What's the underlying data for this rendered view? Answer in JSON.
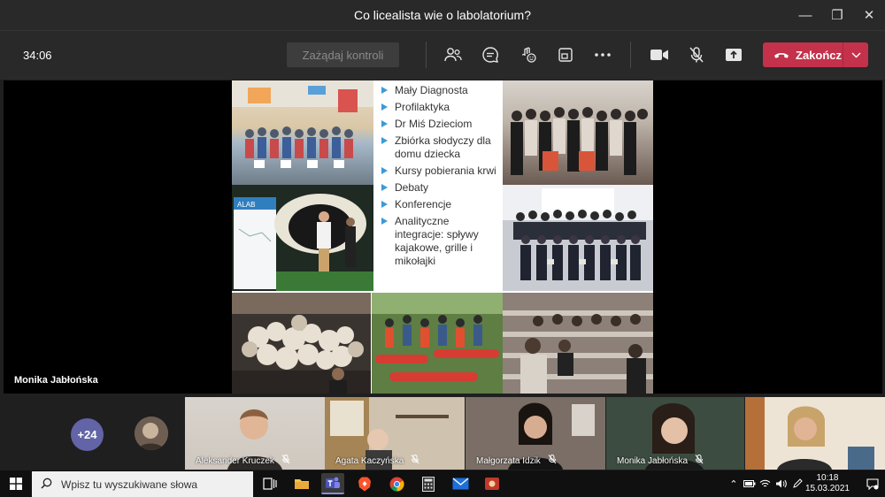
{
  "window": {
    "title": "Co licealista wie o labolatorium?",
    "minimize_icon": "minimize-icon",
    "restore_icon": "restore-icon",
    "close_icon": "close-icon"
  },
  "toolbar": {
    "timer": "34:06",
    "request_control_label": "Zażądaj kontroli",
    "icons": [
      "participants-icon",
      "chat-icon",
      "reactions-icon",
      "rooms-icon",
      "more-icon",
      "camera-icon",
      "mic-off-icon",
      "share-icon"
    ],
    "hangup_label": "Zakończ",
    "hangup_color": "#c4314b"
  },
  "slide": {
    "bullets": [
      "Mały Diagnosta",
      "Profilaktyka",
      "Dr Miś Dzieciom",
      "Zbiórka słodyczy dla domu dziecka",
      "Kursy pobierania krwi",
      "Debaty",
      "Konferencje",
      "Analityczne integracje: spływy kajakowe, grille i mikołajki"
    ],
    "poster_text": "ALAB"
  },
  "stage": {
    "speaker_name": "Monika Jabłońska"
  },
  "gallery": {
    "more_count": "+24",
    "accent": "#6264a7",
    "tiles": [
      {
        "name": "Aleksander Kruczek"
      },
      {
        "name": "Agata Kaczyńska"
      },
      {
        "name": "Małgorzata Idzik"
      },
      {
        "name": "Monika Jabłońska"
      },
      {
        "name": ""
      }
    ]
  },
  "taskbar": {
    "search_placeholder": "Wpisz tu wyszukiwane słowa",
    "time": "10:18",
    "date": "15.03.2021",
    "apps": [
      "task-view-icon",
      "file-explorer-icon",
      "teams-icon",
      "brave-icon",
      "chrome-icon",
      "calculator-icon",
      "mail-icon",
      "app-icon"
    ]
  }
}
